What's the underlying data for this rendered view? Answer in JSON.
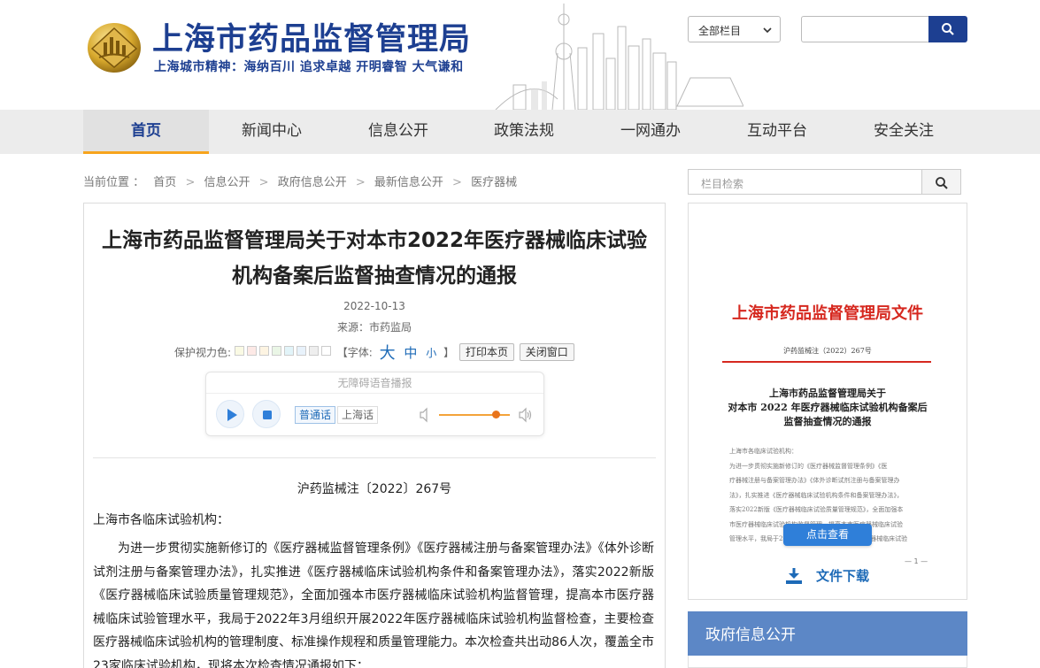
{
  "header": {
    "site_title": "上海市药品监督管理局",
    "slogan": "上海城市精神：海纳百川  追求卓越  开明睿智  大气谦和",
    "category_select": "全部栏目",
    "search_placeholder": ""
  },
  "nav": {
    "items": [
      "首页",
      "新闻中心",
      "信息公开",
      "政策法规",
      "一网通办",
      "互动平台",
      "安全关注"
    ],
    "active_index": 0,
    "active_color": "#1d3f91",
    "accent_underline": "#f7a41d"
  },
  "breadcrumb": {
    "prefix": "当前位置 ：",
    "items": [
      "首页",
      "信息公开",
      "政府信息公开",
      "最新信息公开",
      "医疗器械"
    ]
  },
  "article": {
    "title_line1": "上海市药品监督管理局关于对本市2022年医疗器械临床试验",
    "title_line2": "机构备案后监督抽查情况的通报",
    "date": "2022-10-13",
    "source": "来源：市药监局",
    "eye_protect_label": "保护视力色:",
    "swatch_colors": [
      "#fafae4",
      "#fde9e6",
      "#fdf4e2",
      "#eaf6e6",
      "#e2f4f9",
      "#e8f2fb",
      "#eeeeee",
      "#ffffff"
    ],
    "font_label_open": "【字体:",
    "font_large": "大",
    "font_medium": "中",
    "font_small": "小",
    "font_label_close": "】",
    "print_button": "打印本页",
    "close_button": "关闭窗口",
    "player": {
      "title": "无障碍语音播报",
      "lang_mandarin": "普通话",
      "lang_shanghai": "上海话",
      "volume_level": 0.8
    },
    "doc_number": "沪药监械注〔2022〕267号",
    "salutation": "上海市各临床试验机构：",
    "paragraph": "为进一步贯彻实施新修订的《医疗器械监督管理条例》《医疗器械注册与备案管理办法》《体外诊断试剂注册与备案管理办法》，扎实推进《医疗器械临床试验机构条件和备案管理办法》，落实2022新版《医疗器械临床试验质量管理规范》，全面加强本市医疗器械临床试验机构监督管理，提高本市医疗器械临床试验管理水平，我局于2022年3月组织开展2022年医疗器械临床试验机构监督检查，主要检查医疗器械临床试验机构的管理制度、标准操作规程和质量管理能力。本次检查共出动86人次，覆盖全市23家临床试验机构，现将本次检查情况通报如下："
  },
  "sidebar": {
    "search_placeholder": "栏目检索",
    "doc_preview": {
      "header": "上海市药品监督管理局文件",
      "doc_no": "沪药监械注（2022）267号",
      "subtitle_line1": "上海市药品监督管理局关于",
      "subtitle_line2": "对本市 2022 年医疗器械临床试验机构备案后",
      "subtitle_line3": "监督抽查情况的通报",
      "body_lines": [
        "上海市各临床试验机构：",
        "    为进一步贯彻实施新修订的《医疗器械监督管理条例》《医",
        "疗器械注册与备案管理办法》《体外诊断试剂注册与备案管理办",
        "法》，扎实推进《医疗器械临床试验机构条件和备案管理办法》，",
        "落实2022新版《医疗器械临床试验质量管理规范》，全面加强本",
        "市医疗器械临床试验机构监督管理，提高本市医疗器械临床试验",
        "管理水平，我局于2022年3月组织开展2022年医疗器械临床试验"
      ],
      "page_mark": "— 1 —",
      "view_button": "点击查看",
      "download_label": "文件下载"
    },
    "gov_panel_title": "政府信息公开"
  }
}
